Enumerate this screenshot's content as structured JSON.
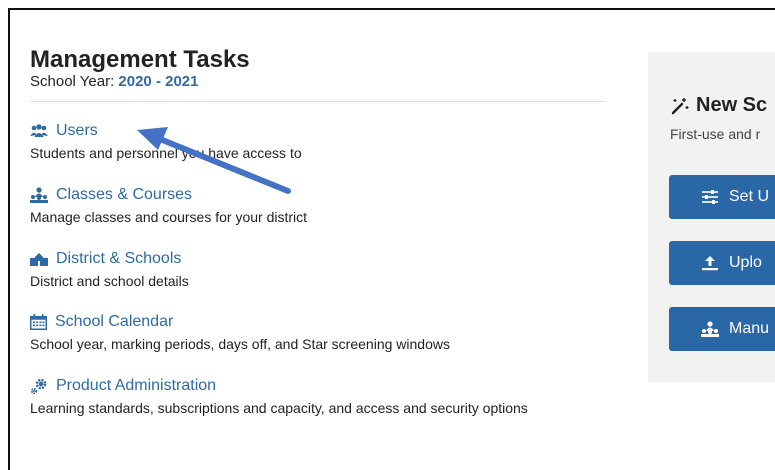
{
  "header": {
    "title": "Management Tasks",
    "year_label": "School Year: ",
    "year_value": "2020 - 2021"
  },
  "tasks": [
    {
      "label": "Users",
      "description": "Students and personnel you have access to",
      "icon": "users-icon"
    },
    {
      "label": "Classes & Courses",
      "description": "Manage classes and courses for your district",
      "icon": "classes-icon"
    },
    {
      "label": "District & Schools",
      "description": "District and school details",
      "icon": "school-building-icon"
    },
    {
      "label": "School Calendar",
      "description": "School year, marking periods, days off, and Star screening windows",
      "icon": "calendar-icon"
    },
    {
      "label": "Product Administration",
      "description": "Learning standards, subscriptions and capacity, and access and security options",
      "icon": "gears-icon"
    }
  ],
  "side_panel": {
    "title": "New Sc",
    "subtitle": "First-use and r",
    "buttons": [
      {
        "label": "Set U",
        "icon": "sliders-icon"
      },
      {
        "label": "Uplo",
        "icon": "upload-icon"
      },
      {
        "label": "Manu",
        "icon": "classes-icon"
      }
    ]
  },
  "colors": {
    "link": "#2f6aa6",
    "button": "#2a67a6",
    "panel_bg": "#f2f2f2",
    "annotation_arrow": "#4472c4"
  }
}
